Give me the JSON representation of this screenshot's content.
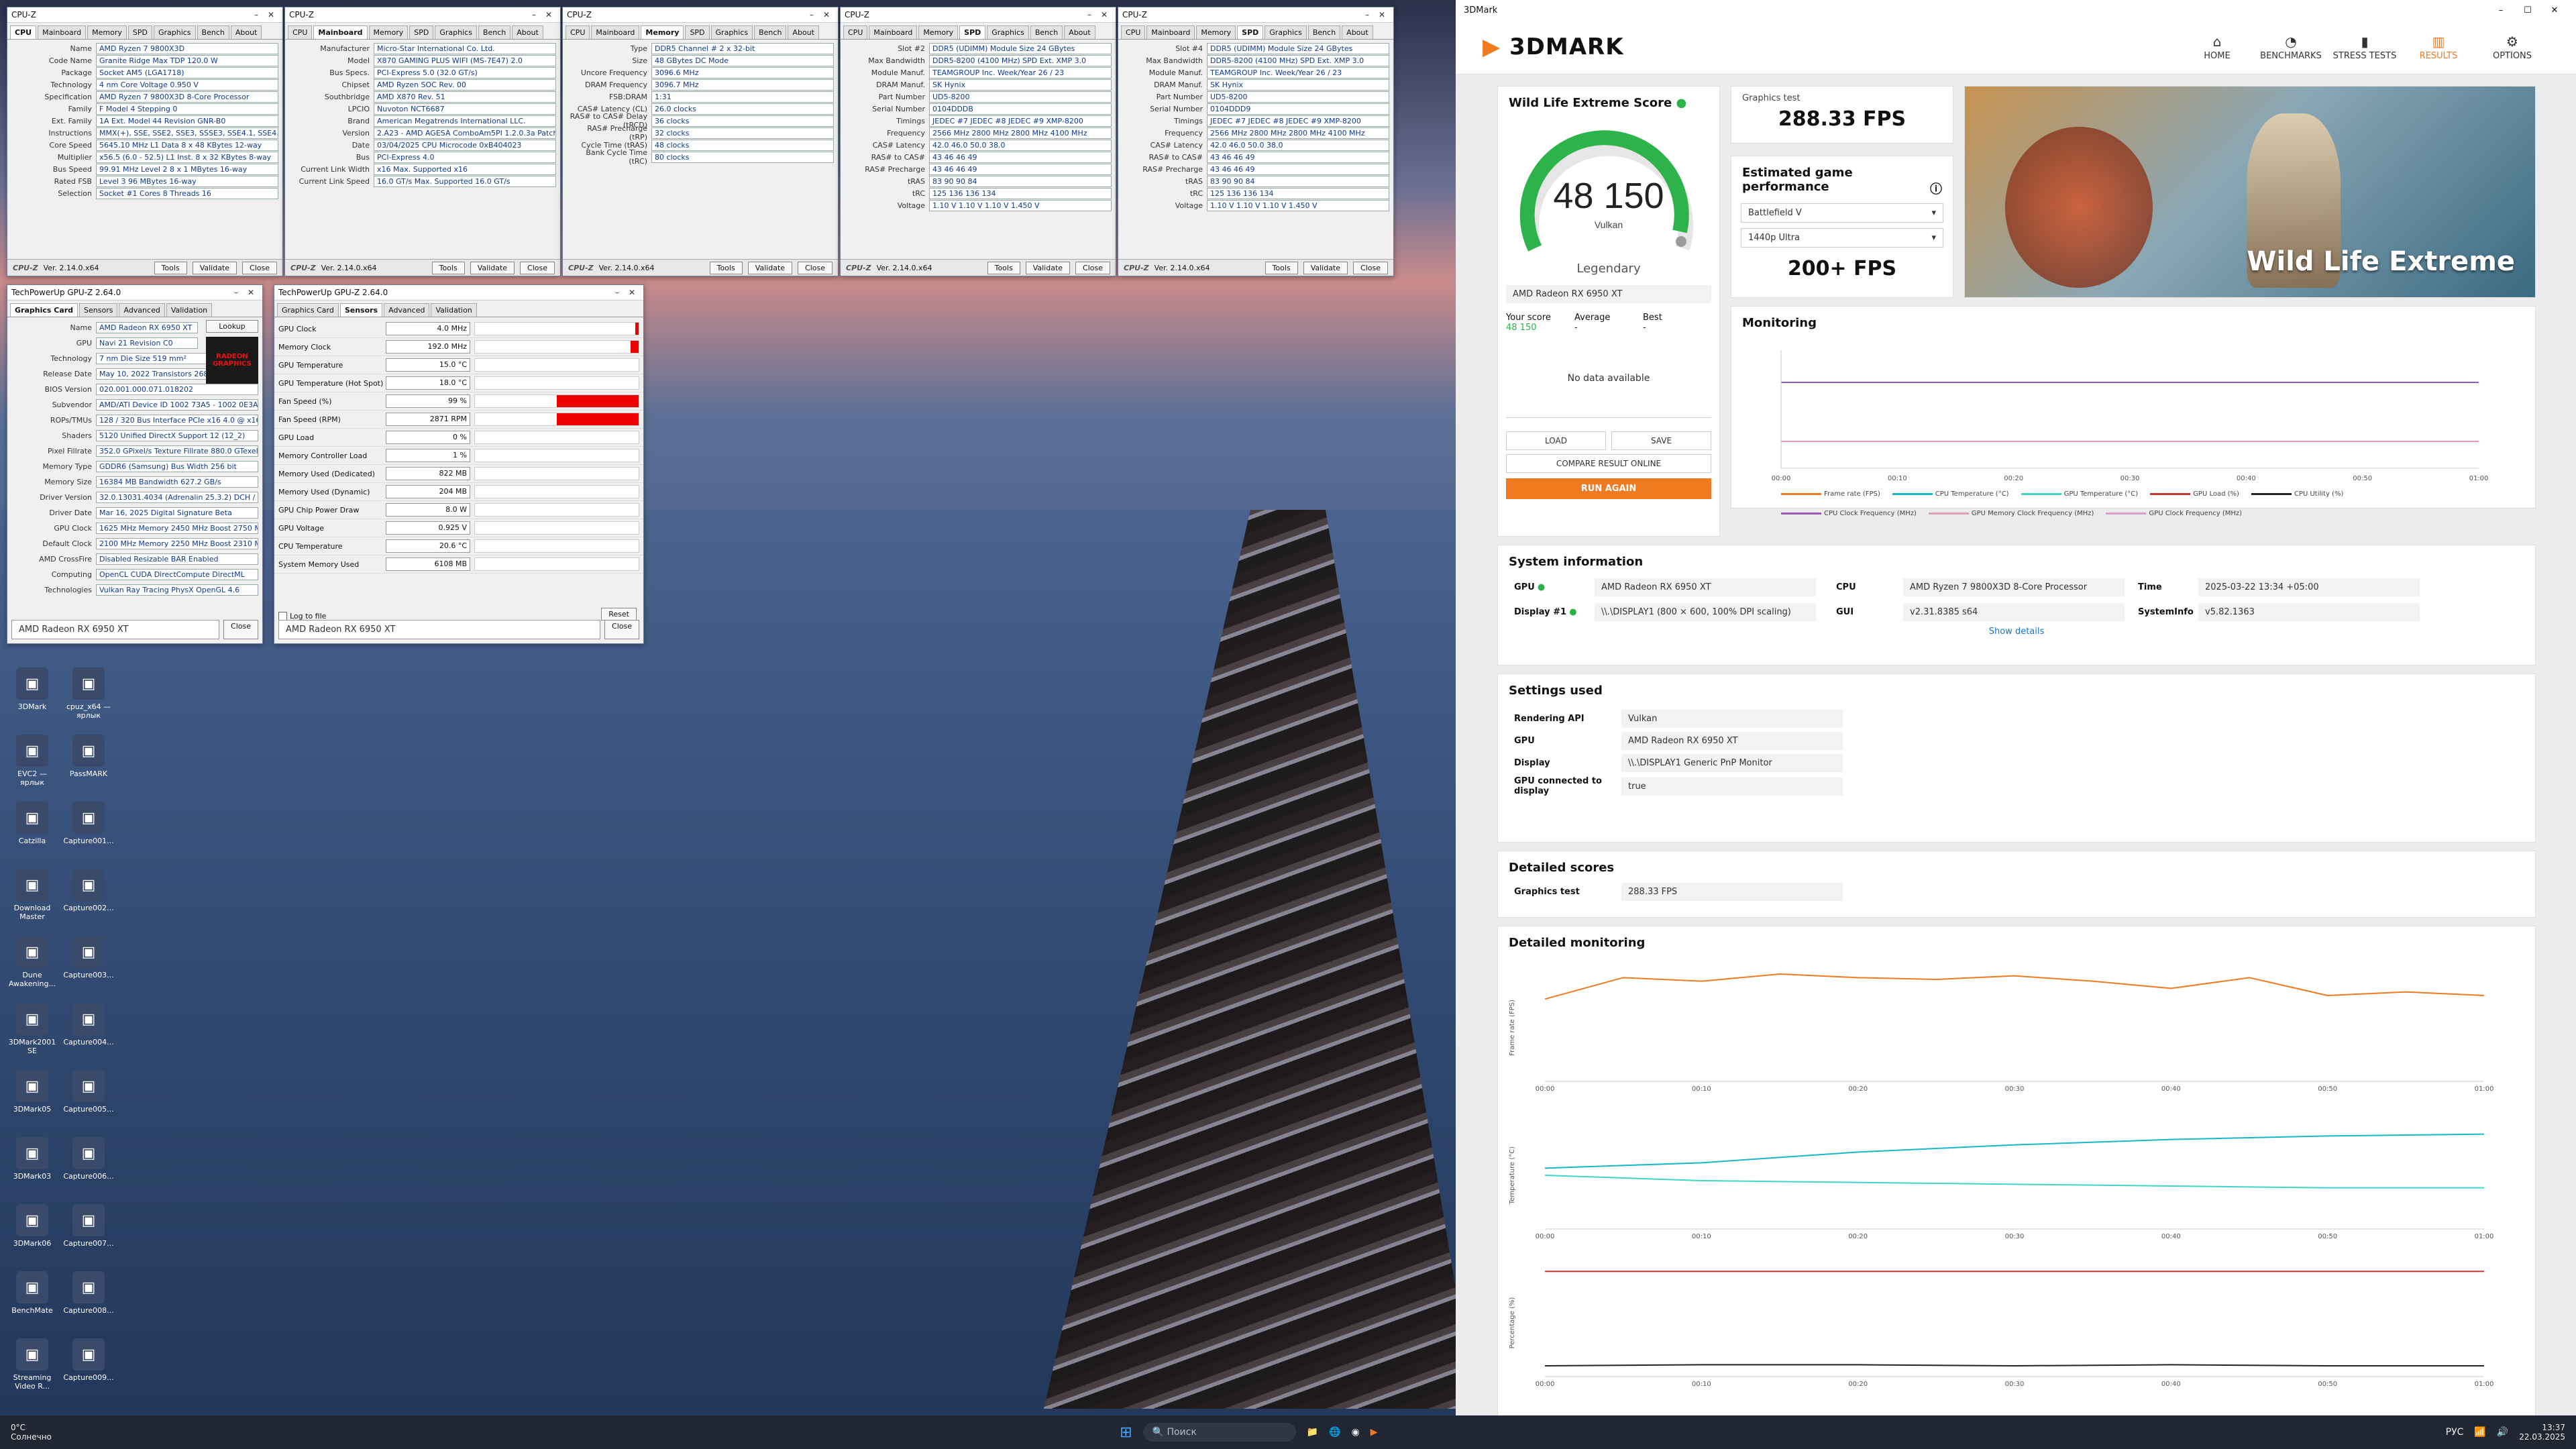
{
  "cpuz_windows": [
    {
      "title": "CPU-Z",
      "tabs": [
        "CPU",
        "Mainboard",
        "Memory",
        "SPD",
        "Graphics",
        "Bench",
        "About"
      ],
      "active_tab": "CPU",
      "fields": [
        {
          "k": "Name",
          "v": "AMD Ryzen 7 9800X3D"
        },
        {
          "k": "Code Name",
          "v": "Granite Ridge   Max TDP 120.0 W"
        },
        {
          "k": "Package",
          "v": "Socket AM5 (LGA1718)"
        },
        {
          "k": "Technology",
          "v": "4 nm   Core Voltage 0.950 V"
        },
        {
          "k": "Specification",
          "v": "AMD Ryzen 7 9800X3D 8-Core Processor"
        },
        {
          "k": "Family",
          "v": "F   Model 4   Stepping 0"
        },
        {
          "k": "Ext. Family",
          "v": "1A   Ext. Model 44   Revision GNR-B0"
        },
        {
          "k": "Instructions",
          "v": "MMX(+), SSE, SSE2, SSE3, SSSE3, SSE4.1, SSE4.2, SSE4A"
        },
        {
          "k": "Core Speed",
          "v": "5645.10 MHz   L1 Data 8 x 48 KBytes 12-way"
        },
        {
          "k": "Multiplier",
          "v": "x56.5 (6.0 - 52.5)   L1 Inst. 8 x 32 KBytes 8-way"
        },
        {
          "k": "Bus Speed",
          "v": "99.91 MHz   Level 2 8 x 1 MBytes 16-way"
        },
        {
          "k": "Rated FSB",
          "v": "Level 3 96 MBytes 16-way"
        },
        {
          "k": "Selection",
          "v": "Socket #1   Cores 8   Threads 16"
        }
      ],
      "version": "Ver. 2.14.0.x64"
    },
    {
      "title": "CPU-Z",
      "tabs": [
        "CPU",
        "Mainboard",
        "Memory",
        "SPD",
        "Graphics",
        "Bench",
        "About"
      ],
      "active_tab": "Mainboard",
      "fields": [
        {
          "k": "Manufacturer",
          "v": "Micro-Star International Co. Ltd."
        },
        {
          "k": "Model",
          "v": "X870 GAMING PLUS WIFI (MS-7E47)   2.0"
        },
        {
          "k": "Bus Specs.",
          "v": "PCI-Express 5.0 (32.0 GT/s)"
        },
        {
          "k": "Chipset",
          "v": "AMD   Ryzen SOC   Rev. 00"
        },
        {
          "k": "Southbridge",
          "v": "AMD   X870   Rev. 51"
        },
        {
          "k": "LPCIO",
          "v": "Nuvoton   NCT6687"
        },
        {
          "k": "Brand",
          "v": "American Megatrends International LLC."
        },
        {
          "k": "Version",
          "v": "2.A23 - AMD AGESA ComboAm5PI 1.2.0.3a Patch A"
        },
        {
          "k": "Date",
          "v": "03/04/2025   CPU Microcode 0xB404023"
        },
        {
          "k": "Bus",
          "v": "PCI-Express 4.0"
        },
        {
          "k": "Current Link Width",
          "v": "x16   Max. Supported x16"
        },
        {
          "k": "Current Link Speed",
          "v": "16.0 GT/s   Max. Supported 16.0 GT/s"
        }
      ],
      "version": "Ver. 2.14.0.x64"
    },
    {
      "title": "CPU-Z",
      "tabs": [
        "CPU",
        "Mainboard",
        "Memory",
        "SPD",
        "Graphics",
        "Bench",
        "About"
      ],
      "active_tab": "Memory",
      "fields": [
        {
          "k": "Type",
          "v": "DDR5   Channel # 2 x 32-bit"
        },
        {
          "k": "Size",
          "v": "48 GBytes   DC Mode"
        },
        {
          "k": "Uncore Frequency",
          "v": "3096.6 MHz"
        },
        {
          "k": "DRAM Frequency",
          "v": "3096.7 MHz"
        },
        {
          "k": "FSB:DRAM",
          "v": "1:31"
        },
        {
          "k": "CAS# Latency (CL)",
          "v": "26.0 clocks"
        },
        {
          "k": "RAS# to CAS# Delay (tRCD)",
          "v": "36 clocks"
        },
        {
          "k": "RAS# Precharge (tRP)",
          "v": "32 clocks"
        },
        {
          "k": "Cycle Time (tRAS)",
          "v": "48 clocks"
        },
        {
          "k": "Bank Cycle Time (tRC)",
          "v": "80 clocks"
        }
      ],
      "version": "Ver. 2.14.0.x64"
    },
    {
      "title": "CPU-Z",
      "tabs": [
        "CPU",
        "Mainboard",
        "Memory",
        "SPD",
        "Graphics",
        "Bench",
        "About"
      ],
      "active_tab": "SPD",
      "fields": [
        {
          "k": "Slot #2",
          "v": "DDR5 (UDIMM)   Module Size 24 GBytes"
        },
        {
          "k": "Max Bandwidth",
          "v": "DDR5-8200 (4100 MHz)   SPD Ext. XMP 3.0"
        },
        {
          "k": "Module Manuf.",
          "v": "TEAMGROUP Inc.   Week/Year 26 / 23"
        },
        {
          "k": "DRAM Manuf.",
          "v": "SK Hynix"
        },
        {
          "k": "Part Number",
          "v": "UD5-8200"
        },
        {
          "k": "Serial Number",
          "v": "0104DDDB"
        },
        {
          "k": "Timings",
          "v": "JEDEC #7  JEDEC #8  JEDEC #9  XMP-8200"
        },
        {
          "k": "Frequency",
          "v": "2566 MHz  2800 MHz  2800 MHz  4100 MHz"
        },
        {
          "k": "CAS# Latency",
          "v": "42.0  46.0  50.0  38.0"
        },
        {
          "k": "RAS# to CAS#",
          "v": "43  46  46  49"
        },
        {
          "k": "RAS# Precharge",
          "v": "43  46  46  49"
        },
        {
          "k": "tRAS",
          "v": "83  90  90  84"
        },
        {
          "k": "tRC",
          "v": "125  136  136  134"
        },
        {
          "k": "Voltage",
          "v": "1.10 V  1.10 V  1.10 V  1.450 V"
        }
      ],
      "version": "Ver. 2.14.0.x64"
    },
    {
      "title": "CPU-Z",
      "tabs": [
        "CPU",
        "Mainboard",
        "Memory",
        "SPD",
        "Graphics",
        "Bench",
        "About"
      ],
      "active_tab": "SPD",
      "fields": [
        {
          "k": "Slot #4",
          "v": "DDR5 (UDIMM)   Module Size 24 GBytes"
        },
        {
          "k": "Max Bandwidth",
          "v": "DDR5-8200 (4100 MHz)   SPD Ext. XMP 3.0"
        },
        {
          "k": "Module Manuf.",
          "v": "TEAMGROUP Inc.   Week/Year 26 / 23"
        },
        {
          "k": "DRAM Manuf.",
          "v": "SK Hynix"
        },
        {
          "k": "Part Number",
          "v": "UD5-8200"
        },
        {
          "k": "Serial Number",
          "v": "0104DDD9"
        },
        {
          "k": "Timings",
          "v": "JEDEC #7  JEDEC #8  JEDEC #9  XMP-8200"
        },
        {
          "k": "Frequency",
          "v": "2566 MHz  2800 MHz  2800 MHz  4100 MHz"
        },
        {
          "k": "CAS# Latency",
          "v": "42.0  46.0  50.0  38.0"
        },
        {
          "k": "RAS# to CAS#",
          "v": "43  46  46  49"
        },
        {
          "k": "RAS# Precharge",
          "v": "43  46  46  49"
        },
        {
          "k": "tRAS",
          "v": "83  90  90  84"
        },
        {
          "k": "tRC",
          "v": "125  136  136  134"
        },
        {
          "k": "Voltage",
          "v": "1.10 V  1.10 V  1.10 V  1.450 V"
        }
      ],
      "version": "Ver. 2.14.0.x64"
    }
  ],
  "cpuz_buttons": {
    "tools": "Tools",
    "validate": "Validate",
    "close": "Close",
    "logo": "CPU-Z"
  },
  "gpuz_main": {
    "title": "TechPowerUp GPU-Z 2.64.0",
    "tabs": [
      "Graphics Card",
      "Sensors",
      "Advanced",
      "Validation"
    ],
    "fields": [
      {
        "k": "Name",
        "v": "AMD Radeon RX 6950 XT"
      },
      {
        "k": "GPU",
        "v": "Navi 21   Revision C0"
      },
      {
        "k": "Technology",
        "v": "7 nm   Die Size 519 mm²"
      },
      {
        "k": "Release Date",
        "v": "May 10, 2022   Transistors 26800M"
      },
      {
        "k": "BIOS Version",
        "v": "020.001.000.071.018202"
      },
      {
        "k": "Subvendor",
        "v": "AMD/ATI   Device ID 1002 73A5 - 1002 0E3A"
      },
      {
        "k": "ROPs/TMUs",
        "v": "128 / 320   Bus Interface PCIe x16 4.0 @ x16 4.0"
      },
      {
        "k": "Shaders",
        "v": "5120 Unified   DirectX Support 12 (12_2)"
      },
      {
        "k": "Pixel Fillrate",
        "v": "352.0 GPixel/s   Texture Fillrate 880.0 GTexel/s"
      },
      {
        "k": "Memory Type",
        "v": "GDDR6 (Samsung)   Bus Width 256 bit"
      },
      {
        "k": "Memory Size",
        "v": "16384 MB   Bandwidth 627.2 GB/s"
      },
      {
        "k": "Driver Version",
        "v": "32.0.13031.4034 (Adrenalin 25.3.2) DCH / Win11 64"
      },
      {
        "k": "Driver Date",
        "v": "Mar 16, 2025   Digital Signature Beta"
      },
      {
        "k": "GPU Clock",
        "v": "1625 MHz   Memory 2450 MHz   Boost 2750 MHz"
      },
      {
        "k": "Default Clock",
        "v": "2100 MHz   Memory 2250 MHz   Boost 2310 MHz"
      },
      {
        "k": "AMD CrossFire",
        "v": "Disabled   Resizable BAR Enabled"
      },
      {
        "k": "Computing",
        "v": "OpenCL  CUDA  DirectCompute  DirectML"
      },
      {
        "k": "Technologies",
        "v": "Vulkan  Ray Tracing  PhysX  OpenGL 4.6"
      }
    ],
    "lookup": "Lookup",
    "selector": "AMD Radeon RX 6950 XT",
    "close": "Close",
    "brand_badge": "RADEON GRAPHICS"
  },
  "gpuz_sensors": {
    "title": "TechPowerUp GPU-Z 2.64.0",
    "tabs": [
      "Graphics Card",
      "Sensors",
      "Advanced",
      "Validation"
    ],
    "rows": [
      {
        "k": "GPU Clock",
        "v": "4.0 MHz",
        "fill": 0.02
      },
      {
        "k": "Memory Clock",
        "v": "192.0 MHz",
        "fill": 0.05
      },
      {
        "k": "GPU Temperature",
        "v": "15.0 °C",
        "fill": 0.0
      },
      {
        "k": "GPU Temperature (Hot Spot)",
        "v": "18.0 °C",
        "fill": 0.0
      },
      {
        "k": "Fan Speed (%)",
        "v": "99 %",
        "fill": 0.5
      },
      {
        "k": "Fan Speed (RPM)",
        "v": "2871 RPM",
        "fill": 0.5
      },
      {
        "k": "GPU Load",
        "v": "0 %",
        "fill": 0.0
      },
      {
        "k": "Memory Controller Load",
        "v": "1 %",
        "fill": 0.0
      },
      {
        "k": "Memory Used (Dedicated)",
        "v": "822 MB",
        "fill": 0.0
      },
      {
        "k": "Memory Used (Dynamic)",
        "v": "204 MB",
        "fill": 0.0
      },
      {
        "k": "GPU Chip Power Draw",
        "v": "8.0 W",
        "fill": 0.0
      },
      {
        "k": "GPU Voltage",
        "v": "0.925 V",
        "fill": 0.0
      },
      {
        "k": "CPU Temperature",
        "v": "20.6 °C",
        "fill": 0.0
      },
      {
        "k": "System Memory Used",
        "v": "6108 MB",
        "fill": 0.0
      }
    ],
    "log_label": "Log to file",
    "reset": "Reset",
    "selector": "AMD Radeon RX 6950 XT",
    "close": "Close"
  },
  "desktop_icons": [
    {
      "label": "3DMark",
      "icon": "3dmark-icon"
    },
    {
      "label": "cpuz_x64 — ярлык",
      "icon": "cpuz-icon"
    },
    {
      "label": "EVC2 — ярлык",
      "icon": "evc2-icon"
    },
    {
      "label": "PassMARK",
      "icon": "passmark-icon"
    },
    {
      "label": "Catzilla",
      "icon": "catzilla-icon"
    },
    {
      "label": "Capture001...",
      "icon": "image-file-icon"
    },
    {
      "label": "Download Master",
      "icon": "download-icon"
    },
    {
      "label": "Capture002...",
      "icon": "image-file-icon"
    },
    {
      "label": "Dune Awakening...",
      "icon": "game-icon"
    },
    {
      "label": "Capture003...",
      "icon": "image-file-icon"
    },
    {
      "label": "3DMark2001 SE",
      "icon": "3dmark-icon"
    },
    {
      "label": "Capture004...",
      "icon": "image-file-icon"
    },
    {
      "label": "3DMark05",
      "icon": "3dmark-icon"
    },
    {
      "label": "Capture005...",
      "icon": "image-file-icon"
    },
    {
      "label": "3DMark03",
      "icon": "3dmark-icon"
    },
    {
      "label": "Capture006...",
      "icon": "image-file-icon"
    },
    {
      "label": "3DMark06",
      "icon": "3dmark-icon"
    },
    {
      "label": "Capture007...",
      "icon": "image-file-icon"
    },
    {
      "label": "BenchMate",
      "icon": "benchmate-icon"
    },
    {
      "label": "Capture008...",
      "icon": "image-file-icon"
    },
    {
      "label": "Streaming Video R...",
      "icon": "video-icon"
    },
    {
      "label": "Capture009...",
      "icon": "image-file-icon"
    }
  ],
  "tdm": {
    "window_title": "3DMark",
    "brand": "3DMARK",
    "nav": [
      {
        "label": "HOME",
        "icon": "home-icon"
      },
      {
        "label": "BENCHMARKS",
        "icon": "benchmarks-icon"
      },
      {
        "label": "STRESS TESTS",
        "icon": "stress-icon"
      },
      {
        "label": "RESULTS",
        "icon": "results-icon",
        "active": true
      },
      {
        "label": "OPTIONS",
        "icon": "gear-icon"
      }
    ],
    "score_card": {
      "title": "Wild Life Extreme Score",
      "score": "48 150",
      "api": "Vulkan",
      "tier": "Legendary",
      "gpu": "AMD Radeon RX 6950 XT",
      "your_score_label": "Your score",
      "your_score": "48 150",
      "average_label": "Average",
      "average": "-",
      "best_label": "Best",
      "best": "-",
      "no_data": "No data available",
      "load": "LOAD",
      "save": "SAVE",
      "compare": "COMPARE RESULT ONLINE",
      "run_again": "RUN AGAIN"
    },
    "graphics_test": {
      "label": "Graphics test",
      "value": "288.33 FPS"
    },
    "estimated": {
      "title": "Estimated game performance",
      "game": "Battlefield V",
      "quality": "1440p Ultra",
      "fps": "200+ FPS"
    },
    "hero_title": "Wild Life Extreme",
    "monitoring": {
      "title": "Monitoring",
      "legend": [
        "Frame rate (FPS)",
        "CPU Temperature (°C)",
        "GPU Temperature (°C)",
        "GPU Load (%)",
        "CPU Utility (%)",
        "CPU Clock Frequency (MHz)",
        "GPU Memory Clock Frequency (MHz)",
        "GPU Clock Frequency (MHz)"
      ],
      "x_ticks": [
        "00:00",
        "00:10",
        "00:20",
        "00:30",
        "00:40",
        "00:50",
        "01:00"
      ]
    },
    "system_info": {
      "title": "System information",
      "gpu_label": "GPU",
      "gpu": "AMD Radeon RX 6950 XT",
      "display_label": "Display #1",
      "display": "\\\\.\\DISPLAY1 (800 × 600, 100% DPI scaling)",
      "cpu_label": "CPU",
      "cpu": "AMD Ryzen 7 9800X3D 8-Core Processor",
      "gui_label": "GUI",
      "gui": "v2.31.8385 s64",
      "time_label": "Time",
      "time": "2025-03-22 13:34 +05:00",
      "sysinfo_label": "SystemInfo",
      "sysinfo": "v5.82.1363",
      "show_details": "Show details"
    },
    "settings": {
      "title": "Settings used",
      "rows": [
        {
          "k": "Rendering API",
          "v": "Vulkan"
        },
        {
          "k": "GPU",
          "v": "AMD Radeon RX 6950 XT"
        },
        {
          "k": "Display",
          "v": "\\\\.\\DISPLAY1 Generic PnP Monitor"
        },
        {
          "k": "GPU connected to display",
          "v": "true"
        }
      ]
    },
    "detailed_scores": {
      "title": "Detailed scores",
      "k": "Graphics test",
      "v": "288.33 FPS"
    },
    "detailed_monitoring": {
      "title": "Detailed monitoring",
      "x_ticks": [
        "00:00",
        "00:10",
        "00:20",
        "00:30",
        "00:40",
        "00:50",
        "01:00"
      ]
    }
  },
  "chart_data": [
    {
      "type": "line",
      "ylabel": "Frame rate (FPS)",
      "ylim": [
        0,
        300
      ],
      "x": [
        0,
        5,
        10,
        15,
        20,
        25,
        30,
        35,
        40,
        45,
        50,
        55,
        60
      ],
      "series": [
        {
          "color": "#f07a20",
          "values": [
            230,
            290,
            280,
            300,
            290,
            285,
            295,
            280,
            260,
            290,
            240,
            250,
            240
          ]
        }
      ]
    },
    {
      "type": "line",
      "ylabel": "Temperature (°C)",
      "ylim": [
        0,
        60
      ],
      "x": [
        0,
        10,
        20,
        30,
        40,
        50,
        60
      ],
      "series": [
        {
          "color": "#19b7c9",
          "values": [
            34,
            37,
            43,
            47,
            50,
            52,
            53
          ]
        },
        {
          "color": "#3fd6c4",
          "values": [
            30,
            27,
            26,
            25,
            24,
            23,
            23
          ]
        }
      ]
    },
    {
      "type": "line",
      "ylabel": "Percentage (%)",
      "ylim": [
        0,
        100
      ],
      "x": [
        0,
        10,
        20,
        30,
        40,
        50,
        60
      ],
      "series": [
        {
          "color": "#c0392b",
          "values": [
            98,
            98,
            98,
            98,
            98,
            98,
            98
          ]
        },
        {
          "color": "#222222",
          "values": [
            10,
            11,
            11,
            10,
            11,
            10,
            10
          ]
        }
      ]
    }
  ],
  "taskbar": {
    "weather": "0°C",
    "weather_desc": "Солнечно",
    "search": "Поиск",
    "lang": "РУС",
    "time": "13:37",
    "date": "22.03.2025"
  },
  "colors": {
    "accent": "#f07a20",
    "cpuz_value": "#103a8a",
    "green": "#2db34a"
  }
}
